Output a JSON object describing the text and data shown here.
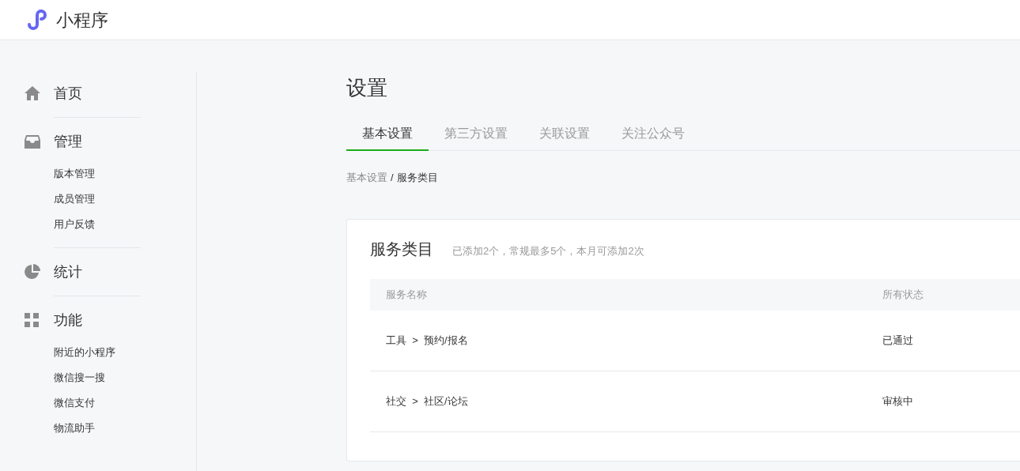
{
  "header": {
    "product_name": "小程序"
  },
  "sidebar": {
    "sections": [
      {
        "kind": "home",
        "label": "首页"
      },
      {
        "kind": "manage",
        "label": "管理",
        "items": [
          "版本管理",
          "成员管理",
          "用户反馈"
        ]
      },
      {
        "kind": "stats",
        "label": "统计"
      },
      {
        "kind": "features",
        "label": "功能",
        "items": [
          "附近的小程序",
          "微信搜一搜",
          "微信支付",
          "物流助手"
        ]
      }
    ]
  },
  "page": {
    "title": "设置",
    "tabs": [
      {
        "label": "基本设置",
        "selected": true
      },
      {
        "label": "第三方设置",
        "selected": false
      },
      {
        "label": "关联设置",
        "selected": false
      },
      {
        "label": "关注公众号",
        "selected": false
      }
    ],
    "breadcrumb": {
      "parent": "基本设置",
      "separator": "/",
      "current": "服务类目"
    },
    "card": {
      "title": "服务类目",
      "note": "已添加2个，常规最多5个，本月可添加2次",
      "table": {
        "columns": [
          "服务名称",
          "所有状态"
        ],
        "rows": [
          {
            "category": "工具",
            "arrow": ">",
            "subcategory": "预约/报名",
            "status": "已通过"
          },
          {
            "category": "社交",
            "arrow": ">",
            "subcategory": "社区/论坛",
            "status": "审核中"
          }
        ]
      }
    }
  }
}
